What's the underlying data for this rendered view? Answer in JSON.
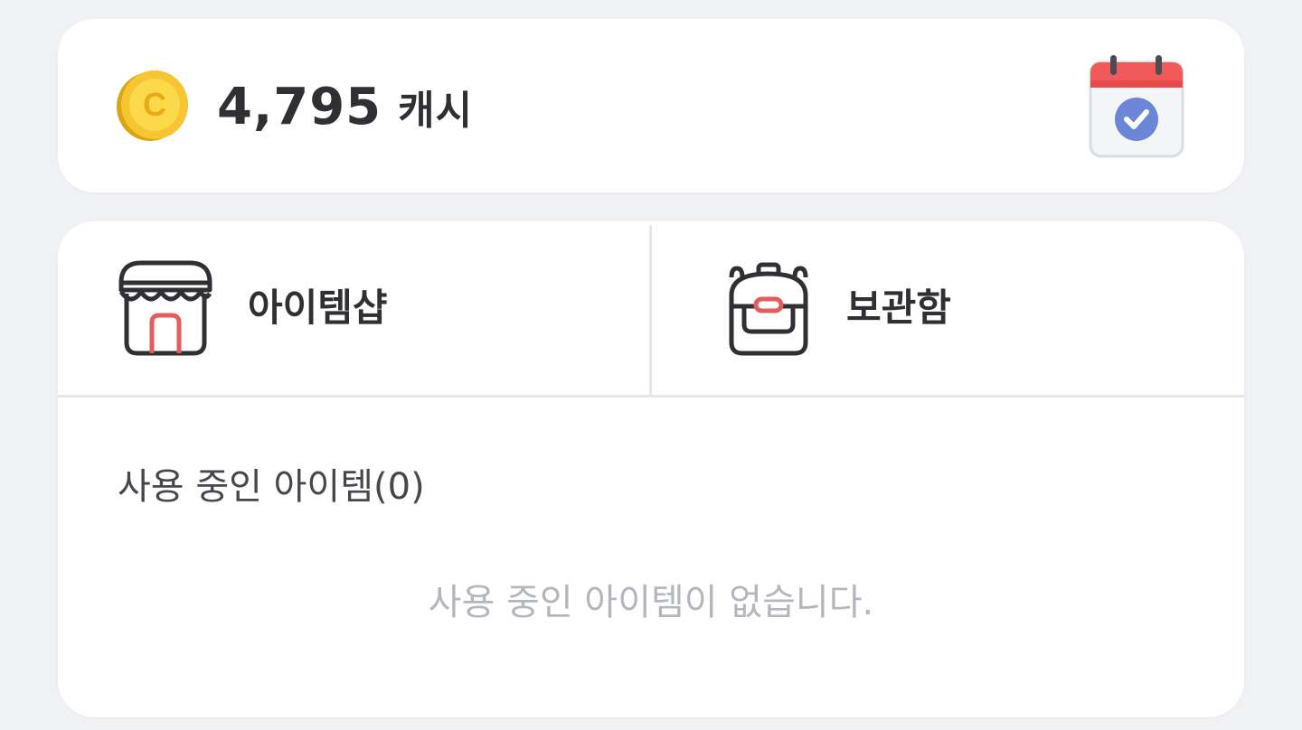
{
  "cash": {
    "amount": "4,795",
    "unit": "캐시",
    "coin_icon": "coin-icon",
    "calendar_icon": "calendar-check-icon"
  },
  "menu": {
    "shop": {
      "label": "아이템샵",
      "icon": "shop-icon"
    },
    "storage": {
      "label": "보관함",
      "icon": "backpack-icon"
    }
  },
  "items_in_use": {
    "title": "사용 중인 아이템(0)",
    "empty_message": "사용 중인 아이템이 없습니다."
  },
  "colors": {
    "background": "#eff1f4",
    "card": "#ffffff",
    "coin": "#f6c531",
    "calendar_header": "#f05a5a",
    "check": "#6b86d6",
    "accent_red": "#e35d5d",
    "text_primary": "#2f3033",
    "text_muted": "#b3b7bd"
  }
}
